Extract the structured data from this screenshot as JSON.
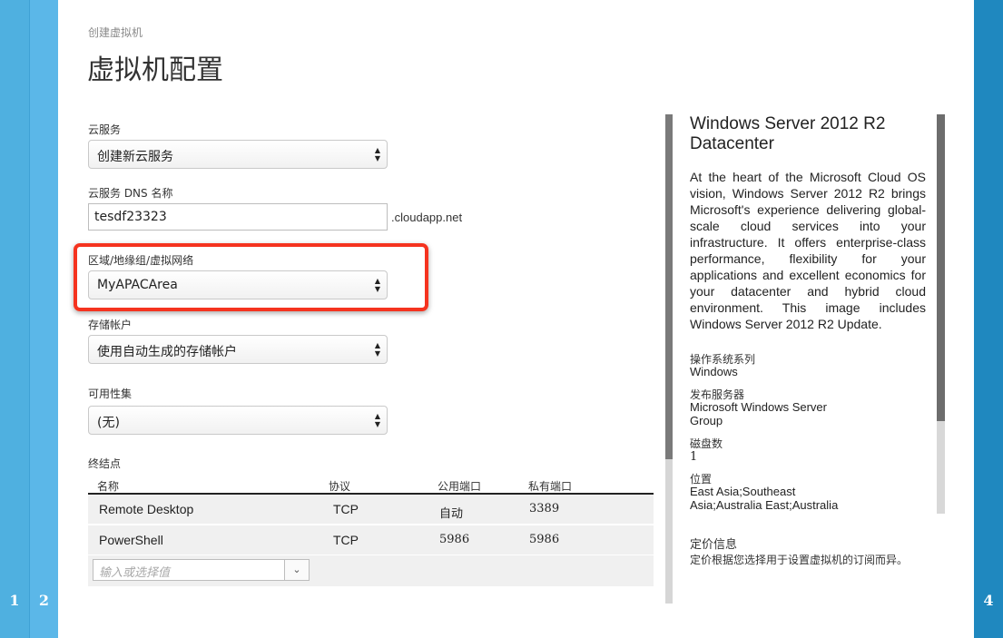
{
  "steps": {
    "step1": "1",
    "step2": "2",
    "step4": "4"
  },
  "breadcrumb": "创建虚拟机",
  "page_title": "虚拟机配置",
  "form": {
    "cloud_service": {
      "label": "云服务",
      "value": "创建新云服务"
    },
    "dns_name": {
      "label": "云服务 DNS 名称",
      "value": "tesdf23323",
      "suffix": ".cloudapp.net"
    },
    "region": {
      "label": "区域/地缘组/虚拟网络",
      "value": "MyAPACArea"
    },
    "storage_account": {
      "label": "存储帐户",
      "value": "使用自动生成的存储帐户"
    },
    "availability_set": {
      "label": "可用性集",
      "value": "(无)"
    }
  },
  "endpoints": {
    "label": "终结点",
    "columns": [
      "名称",
      "协议",
      "公用端口",
      "私有端口"
    ],
    "rows": [
      {
        "name": "Remote Desktop",
        "protocol": "TCP",
        "public_port": "自动",
        "private_port": "3389"
      },
      {
        "name": "PowerShell",
        "protocol": "TCP",
        "public_port": "5986",
        "private_port": "5986"
      }
    ],
    "add_placeholder": "输入或选择值"
  },
  "image_info": {
    "title": "Windows Server 2012 R2 Datacenter",
    "description": "At the heart of the Microsoft Cloud OS vision, Windows Server 2012 R2 brings Microsoft's experience delivering global-scale cloud services into your infrastructure. It offers enterprise-class performance, flexibility for your applications and excellent economics for your datacenter and hybrid cloud environment. This image includes Windows Server 2012 R2 Update.",
    "os_family_label": "操作系统系列",
    "os_family_value": "Windows",
    "publisher_label": "发布服务器",
    "publisher_value": "Microsoft Windows Server Group",
    "disks_label": "磁盘数",
    "disks_value": "1",
    "location_label": "位置",
    "location_value": "East Asia;Southeast Asia;Australia East;Australia",
    "pricing_label": "定价信息",
    "pricing_value": "定价根据您选择用于设置虚拟机的订阅而异。"
  },
  "colors": {
    "highlight": "#f5331f",
    "rail_light": "#4fb0e0",
    "rail_dark": "#1f88bf"
  }
}
